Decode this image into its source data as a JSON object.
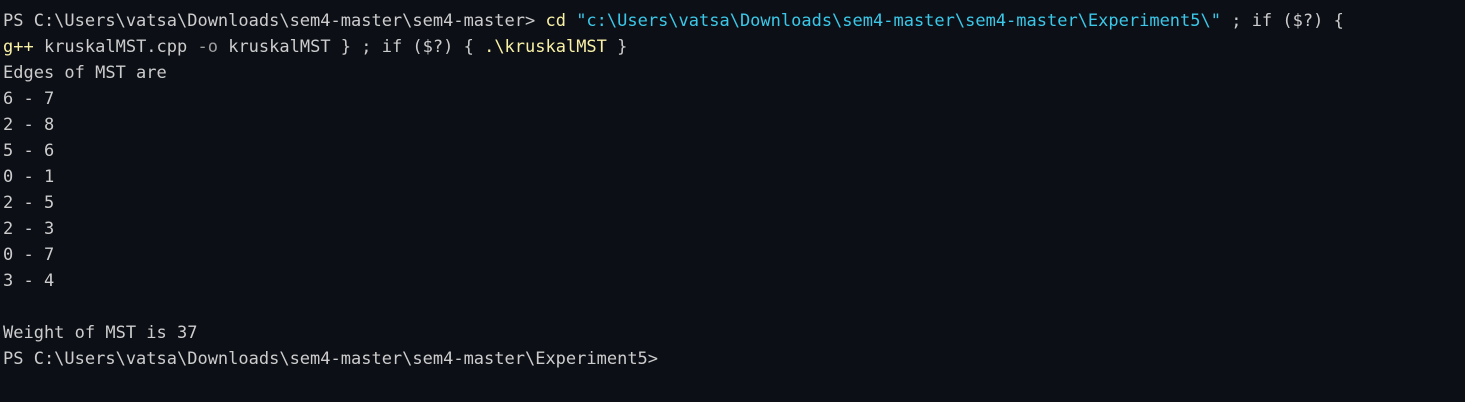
{
  "terminal": {
    "colors": {
      "background": "#0c0f16",
      "text": "#cccccc",
      "command": "#f9f1a5",
      "string": "#3bc8e8",
      "parameter": "#9e9e9e"
    },
    "command_line1": {
      "prompt": "PS C:\\Users\\vatsa\\Downloads\\sem4-master\\sem4-master> ",
      "cd": "cd",
      "path": "\"c:\\Users\\vatsa\\Downloads\\sem4-master\\sem4-master\\Experiment5\\\"",
      "after_path": " ; if ($?) {"
    },
    "command_line2": {
      "gpp": "g++",
      "file": " kruskalMST.cpp ",
      "flag": "-o",
      "out": " kruskalMST } ; if ($?) { ",
      "run": ".\\kruskalMST",
      "close": " }"
    },
    "output_header": "Edges of MST are",
    "edges": [
      "6 - 7",
      "2 - 8",
      "5 - 6",
      "0 - 1",
      "2 - 5",
      "2 - 3",
      "0 - 7",
      "3 - 4"
    ],
    "blank": "",
    "weight_line": "Weight of MST is 37",
    "final_prompt": "PS C:\\Users\\vatsa\\Downloads\\sem4-master\\sem4-master\\Experiment5>"
  }
}
